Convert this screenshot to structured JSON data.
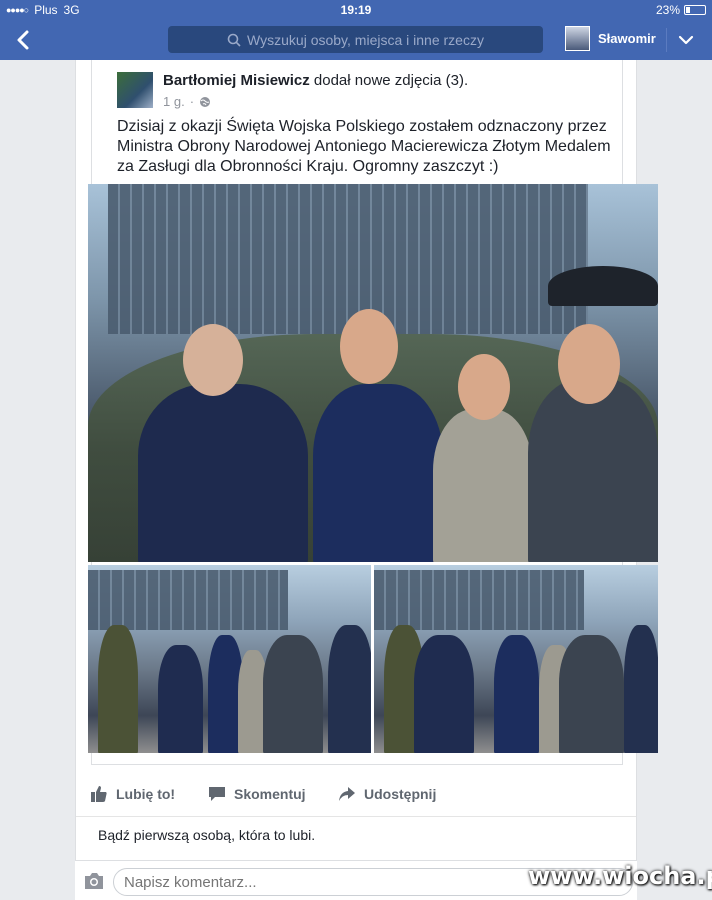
{
  "status_bar": {
    "carrier": "Plus",
    "network": "3G",
    "time": "19:19",
    "battery_percent": "23%",
    "battery_level": 0.23
  },
  "nav": {
    "search_placeholder": "Wyszukuj osoby, miejsca i inne rzeczy",
    "profile_name": "Sławomir",
    "back_icon": "chevron-left-icon",
    "menu_icon": "chevron-down-icon"
  },
  "post": {
    "author": "Bartłomiej Misiewicz",
    "action": "dodał nowe zdjęcia (3).",
    "time": "1 g.",
    "privacy_icon": "globe-icon",
    "text": "Dzisiaj z okazji Święta Wojska Polskiego zostałem odznaczony przez Ministra Obrony Narodowej Antoniego Macierewicza Złotym Medalem za Zasługi dla Obronności Kraju. Ogromny zaszczyt :)",
    "photo_count": 3
  },
  "actions": {
    "like": "Lubię to!",
    "comment": "Skomentuj",
    "share": "Udostępnij"
  },
  "likes_text": "Bądź pierwszą osobą, która to lubi.",
  "comment_placeholder": "Napisz komentarz...",
  "watermark": "www.wiocha.pl",
  "colors": {
    "brand": "#4267b2",
    "search_bg": "#29487d",
    "text": "#1d2129",
    "meta": "#90949c"
  }
}
